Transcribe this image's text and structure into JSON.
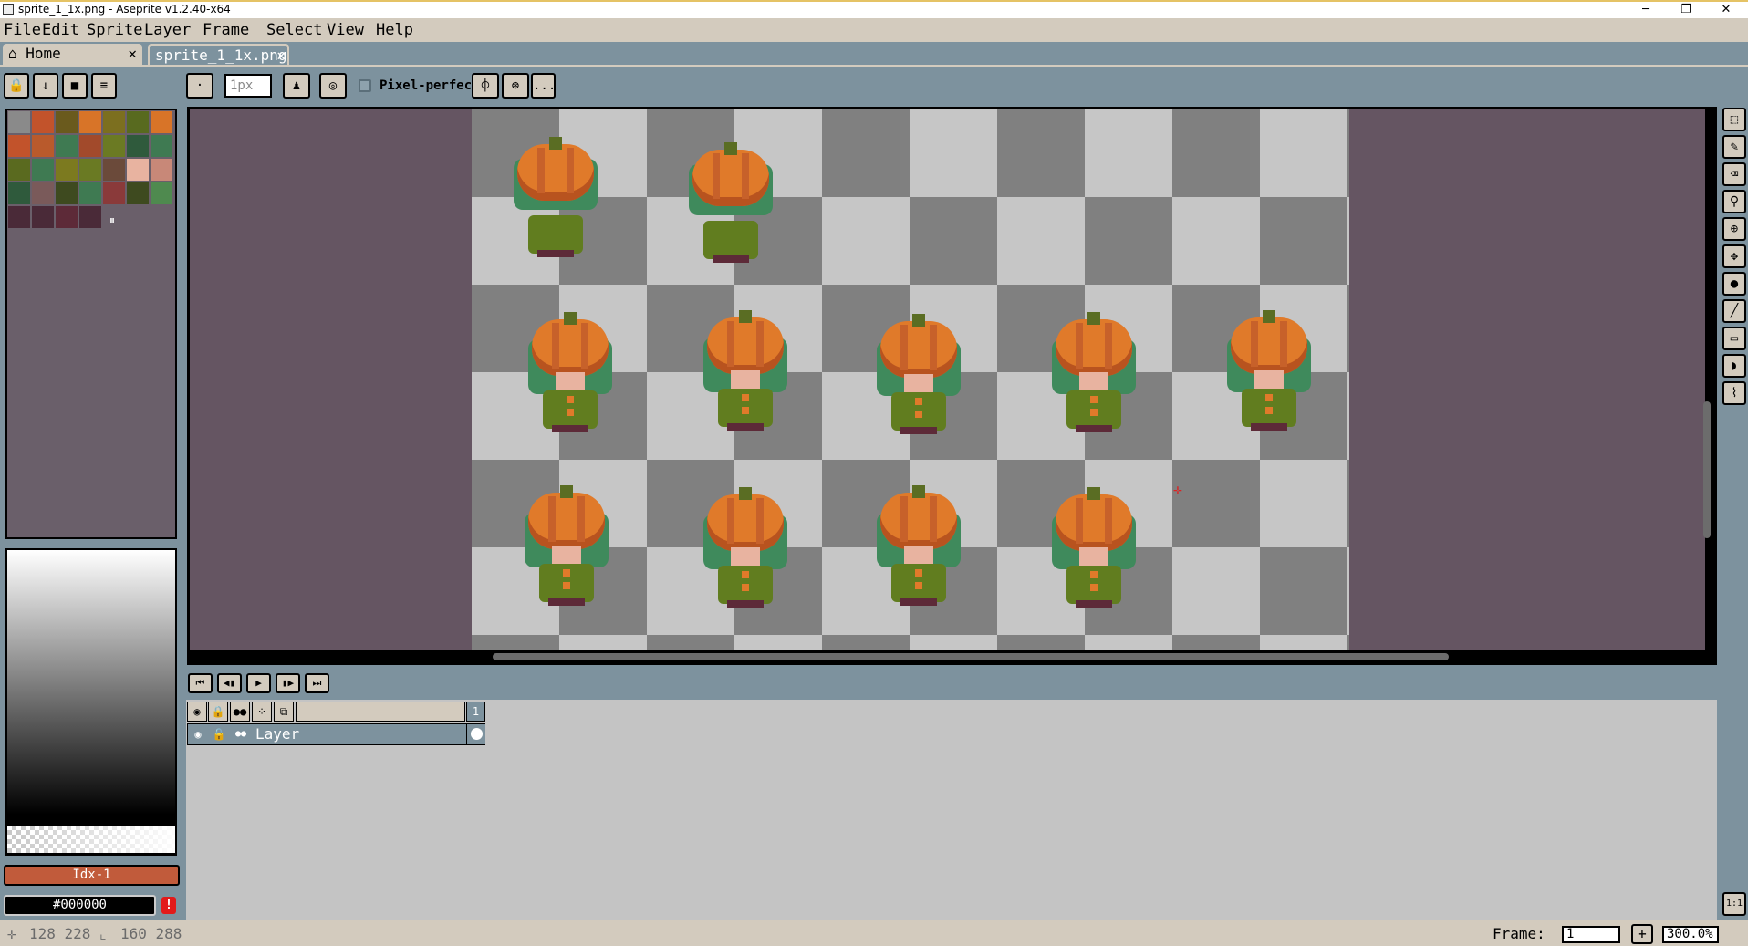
{
  "window": {
    "title": "sprite_1_1x.png - Aseprite v1.2.40-x64",
    "minimize": "─",
    "restore": "❐",
    "close": "✕"
  },
  "menu": [
    "File",
    "Edit",
    "Sprite",
    "Layer",
    "Frame",
    "Select",
    "View",
    "Help"
  ],
  "tabs": {
    "home": "Home",
    "home_icon": "house-icon",
    "sprite": "sprite_1_1x.png",
    "close_glyph": "✕"
  },
  "toolbar": {
    "brush_size": "1px",
    "pixel_perfect": "Pixel-perfect",
    "more": "..."
  },
  "palette": {
    "colors": [
      "#8a8a8a",
      "#c2532b",
      "#6a5a1d",
      "#d87428",
      "#7c6f1f",
      "#586a1f",
      "#d87428",
      "#c2532b",
      "#b95a2c",
      "#3f7a52",
      "#a24a2b",
      "#6b7a23",
      "#2f5a3c",
      "#3f7a52",
      "#5a6a1f",
      "#3f7a52",
      "#7c7a1f",
      "#6a7a23",
      "#6b4a3a",
      "#e8b3a0",
      "#c88878",
      "#2f5a3c",
      "#7a5a5a",
      "#3e4a1f",
      "#3f7a52",
      "#8a3a3a",
      "#3e4a1f",
      "#4f8a4f",
      "#4a2a38",
      "#4a2a38",
      "#5d2a38",
      "#4a2a38"
    ],
    "more": "⏸"
  },
  "colorbar": {
    "fg_label": "Idx-1",
    "bg_label": "#000000",
    "warning": "!"
  },
  "layers": {
    "header_frame": "1",
    "layer_name": "Layer"
  },
  "status": {
    "pos_icon": "crosshair-icon",
    "position": "128 228",
    "size_icon": "selection-size-icon",
    "size": "160 288",
    "frame_label": "Frame:",
    "frame_value": "1",
    "add": "+",
    "zoom": "300.0%"
  },
  "right_tools": {
    "reset_zoom": "1:1"
  }
}
